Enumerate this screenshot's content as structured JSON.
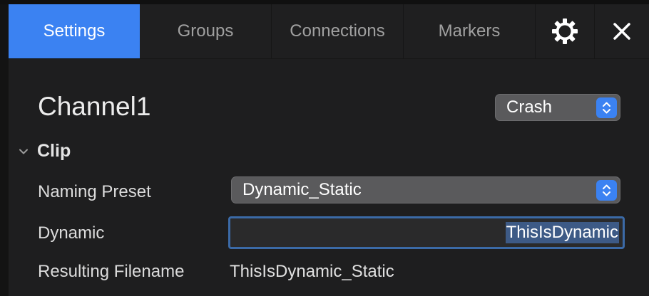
{
  "tabs": [
    {
      "label": "Settings",
      "active": true
    },
    {
      "label": "Groups",
      "active": false
    },
    {
      "label": "Connections",
      "active": false
    },
    {
      "label": "Markers",
      "active": false
    }
  ],
  "toolbar": {
    "settings_icon": "gear-icon",
    "close_icon": "close-icon"
  },
  "channel": {
    "title": "Channel1",
    "mode": "Crash"
  },
  "clip": {
    "section_label": "Clip",
    "naming_preset_label": "Naming Preset",
    "naming_preset_value": "Dynamic_Static",
    "dynamic_label": "Dynamic",
    "dynamic_value": "ThisIsDynamic",
    "resulting_filename_label": "Resulting Filename",
    "resulting_filename_value": "ThisIsDynamic_Static"
  },
  "colors": {
    "accent": "#3b82f2",
    "panel": "#1e1e1f",
    "popup": "#5a5a5c",
    "selection": "#3d5a86",
    "focus_ring": "#3b6aa7"
  }
}
